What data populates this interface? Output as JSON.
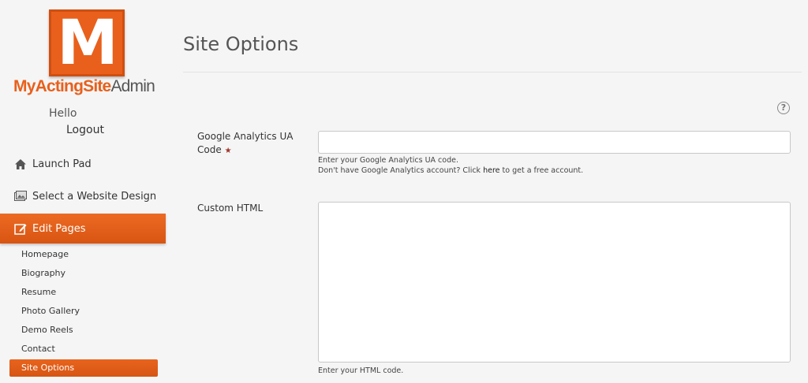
{
  "logo": {
    "letter": "M",
    "text_orange_1": "MyActing",
    "text_orange_2": "Site",
    "text_grey": "Admin"
  },
  "user": {
    "greeting": "Hello",
    "logout": "Logout"
  },
  "nav": {
    "launch_pad": "Launch Pad",
    "select_design": "Select a Website Design",
    "edit_pages": "Edit Pages",
    "sub_items": [
      "Homepage",
      "Biography",
      "Resume",
      "Photo Gallery",
      "Demo Reels",
      "Contact",
      "Site Options"
    ]
  },
  "main": {
    "title": "Site Options",
    "help_symbol": "?",
    "ga_field": {
      "label": "Google Analytics UA Code",
      "required_mark": "★",
      "value": "",
      "help_line1": "Enter your Google Analytics UA code.",
      "help_line2_pre": "Don't have Google Analytics account? Click ",
      "help_line2_link": "here",
      "help_line2_post": " to get a free account."
    },
    "html_field": {
      "label": "Custom HTML",
      "value": "",
      "help": "Enter your HTML code."
    }
  },
  "colors": {
    "accent": "#e8601c",
    "background": "#f5f5f5"
  }
}
